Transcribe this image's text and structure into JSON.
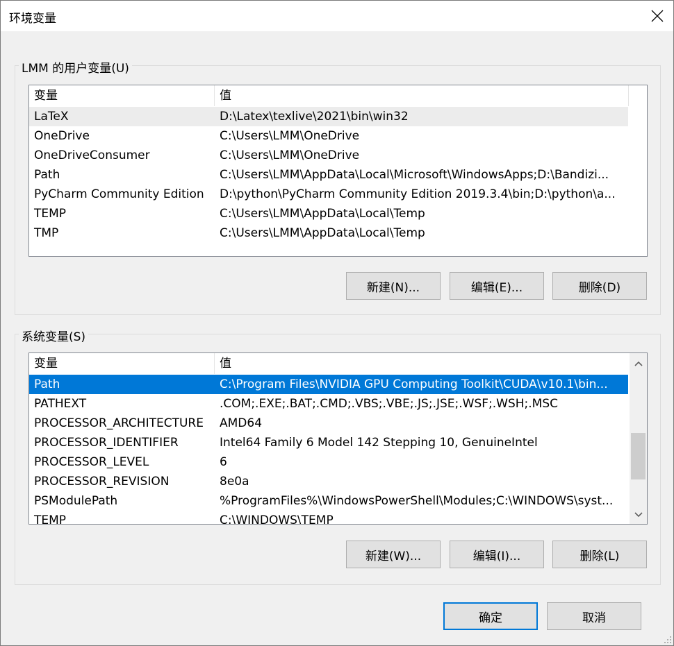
{
  "window": {
    "title": "环境变量"
  },
  "user_vars": {
    "group_label": "LMM 的用户变量(U)",
    "columns": [
      "变量",
      "值"
    ],
    "rows": [
      {
        "name": "LaTeX",
        "value": "D:\\Latex\\texlive\\2021\\bin\\win32"
      },
      {
        "name": "OneDrive",
        "value": "C:\\Users\\LMM\\OneDrive"
      },
      {
        "name": "OneDriveConsumer",
        "value": "C:\\Users\\LMM\\OneDrive"
      },
      {
        "name": "Path",
        "value": "C:\\Users\\LMM\\AppData\\Local\\Microsoft\\WindowsApps;D:\\Bandizi..."
      },
      {
        "name": "PyCharm Community Edition",
        "value": "D:\\python\\PyCharm Community Edition 2019.3.4\\bin;D:\\python\\a..."
      },
      {
        "name": "TEMP",
        "value": "C:\\Users\\LMM\\AppData\\Local\\Temp"
      },
      {
        "name": "TMP",
        "value": "C:\\Users\\LMM\\AppData\\Local\\Temp"
      }
    ],
    "hover_row": "LaTeX",
    "buttons": {
      "new": "新建(N)...",
      "edit": "编辑(E)...",
      "delete": "删除(D)"
    }
  },
  "system_vars": {
    "group_label": "系统变量(S)",
    "columns": [
      "变量",
      "值"
    ],
    "rows": [
      {
        "name": "Path",
        "value": "C:\\Program Files\\NVIDIA GPU Computing Toolkit\\CUDA\\v10.1\\bin..."
      },
      {
        "name": "PATHEXT",
        "value": ".COM;.EXE;.BAT;.CMD;.VBS;.VBE;.JS;.JSE;.WSF;.WSH;.MSC"
      },
      {
        "name": "PROCESSOR_ARCHITECTURE",
        "value": "AMD64"
      },
      {
        "name": "PROCESSOR_IDENTIFIER",
        "value": "Intel64 Family 6 Model 142 Stepping 10, GenuineIntel"
      },
      {
        "name": "PROCESSOR_LEVEL",
        "value": "6"
      },
      {
        "name": "PROCESSOR_REVISION",
        "value": "8e0a"
      },
      {
        "name": "PSModulePath",
        "value": "%ProgramFiles%\\WindowsPowerShell\\Modules;C:\\WINDOWS\\syst..."
      },
      {
        "name": "TEMP",
        "value": "C:\\WINDOWS\\TEMP"
      }
    ],
    "selected_row": "Path",
    "buttons": {
      "new": "新建(W)...",
      "edit": "编辑(I)...",
      "delete": "删除(L)"
    }
  },
  "footer": {
    "ok": "确定",
    "cancel": "取消"
  },
  "colors": {
    "accent": "#0078d7"
  }
}
